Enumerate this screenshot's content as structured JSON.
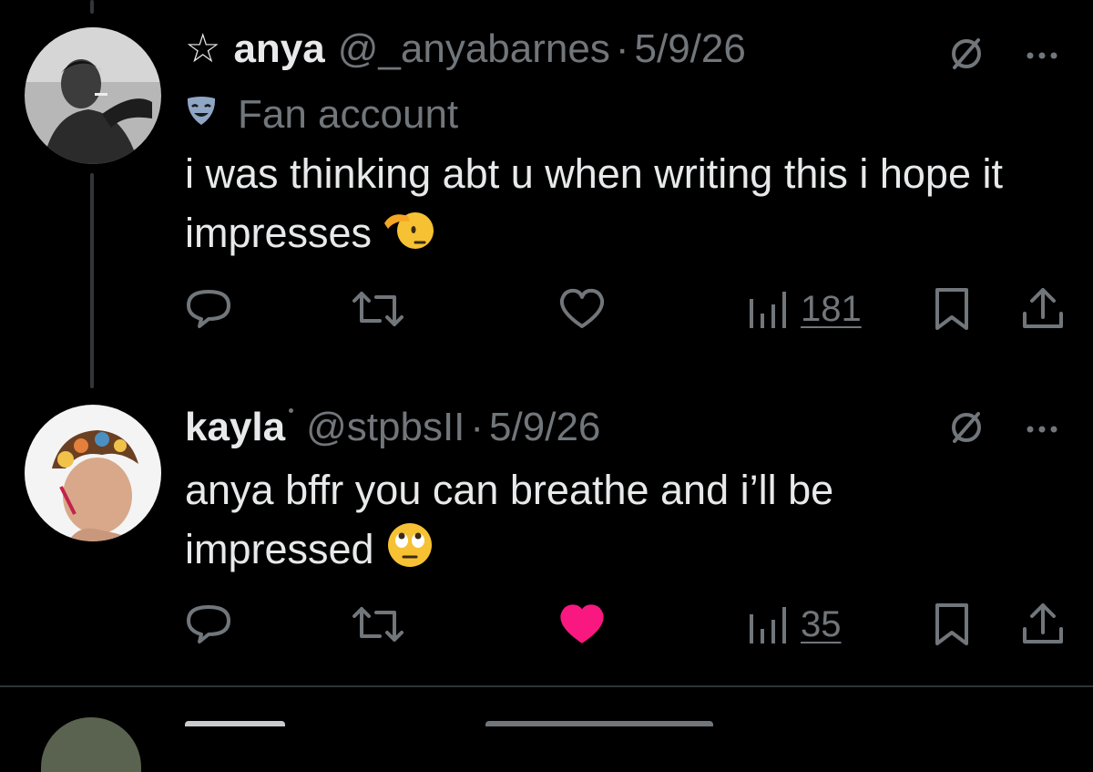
{
  "tweets": [
    {
      "display_name": "anya",
      "has_star": true,
      "star_glyph": "☆",
      "handle": "@_anyabarnes",
      "separator": "·",
      "date": "5/9/26",
      "label": "Fan account",
      "text": "i was thinking abt u when writing this i hope it impresses",
      "emoji": "saluting-face",
      "liked": false,
      "views": "181"
    },
    {
      "display_name": "kayla",
      "handle": "@stpbsII",
      "separator": "·",
      "date": "5/9/26",
      "text": "anya bffr you can breathe and i’ll be impressed",
      "emoji": "face-with-rolling-eyes",
      "liked": true,
      "views": "35"
    }
  ],
  "colors": {
    "background": "#000000",
    "primary_text": "#e7e9ea",
    "secondary_text": "#71767b",
    "like_active": "#f91880",
    "divider": "#2f3336"
  },
  "icons": [
    "star-icon",
    "grok-icon",
    "more-icon",
    "mask-icon",
    "reply-icon",
    "retweet-icon",
    "like-icon",
    "views-icon",
    "bookmark-icon",
    "share-icon"
  ]
}
